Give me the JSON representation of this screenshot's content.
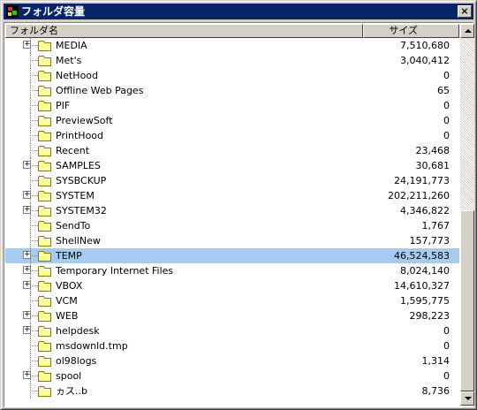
{
  "window": {
    "title": "フォルダ容量",
    "close_label": "×"
  },
  "columns": {
    "name": "フォルダ名",
    "size": "サイズ"
  },
  "rows": [
    {
      "name": "MEDIA",
      "size": "7,510,680",
      "expandable": true,
      "selected": false
    },
    {
      "name": "Met's",
      "size": "3,040,412",
      "expandable": false,
      "selected": false
    },
    {
      "name": "NetHood",
      "size": "0",
      "expandable": false,
      "selected": false
    },
    {
      "name": "Offline Web Pages",
      "size": "65",
      "expandable": false,
      "selected": false
    },
    {
      "name": "PIF",
      "size": "0",
      "expandable": false,
      "selected": false
    },
    {
      "name": "PreviewSoft",
      "size": "0",
      "expandable": false,
      "selected": false
    },
    {
      "name": "PrintHood",
      "size": "0",
      "expandable": false,
      "selected": false
    },
    {
      "name": "Recent",
      "size": "23,468",
      "expandable": false,
      "selected": false
    },
    {
      "name": "SAMPLES",
      "size": "30,681",
      "expandable": true,
      "selected": false
    },
    {
      "name": "SYSBCKUP",
      "size": "24,191,773",
      "expandable": false,
      "selected": false
    },
    {
      "name": "SYSTEM",
      "size": "202,211,260",
      "expandable": true,
      "selected": false
    },
    {
      "name": "SYSTEM32",
      "size": "4,346,822",
      "expandable": true,
      "selected": false
    },
    {
      "name": "SendTo",
      "size": "1,767",
      "expandable": false,
      "selected": false
    },
    {
      "name": "ShellNew",
      "size": "157,773",
      "expandable": false,
      "selected": false
    },
    {
      "name": "TEMP",
      "size": "46,524,583",
      "expandable": true,
      "selected": true
    },
    {
      "name": "Temporary Internet Files",
      "size": "8,024,140",
      "expandable": true,
      "selected": false
    },
    {
      "name": "VBOX",
      "size": "14,610,327",
      "expandable": true,
      "selected": false
    },
    {
      "name": "VCM",
      "size": "1,595,775",
      "expandable": false,
      "selected": false
    },
    {
      "name": "WEB",
      "size": "298,223",
      "expandable": true,
      "selected": false
    },
    {
      "name": "helpdesk",
      "size": "0",
      "expandable": true,
      "selected": false
    },
    {
      "name": "msdownld.tmp",
      "size": "0",
      "expandable": false,
      "selected": false
    },
    {
      "name": "ol98logs",
      "size": "1,314",
      "expandable": false,
      "selected": false
    },
    {
      "name": "spool",
      "size": "0",
      "expandable": true,
      "selected": false
    },
    {
      "name": "ヵス..b",
      "size": "8,736",
      "expandable": false,
      "selected": false
    }
  ],
  "icons": {
    "app": "app-icon",
    "folder": "folder-icon",
    "expand": "plus-box-icon"
  },
  "colors": {
    "titlebar": "#0a246a",
    "selection": "#a6caf0",
    "folder": "#ffff99"
  }
}
